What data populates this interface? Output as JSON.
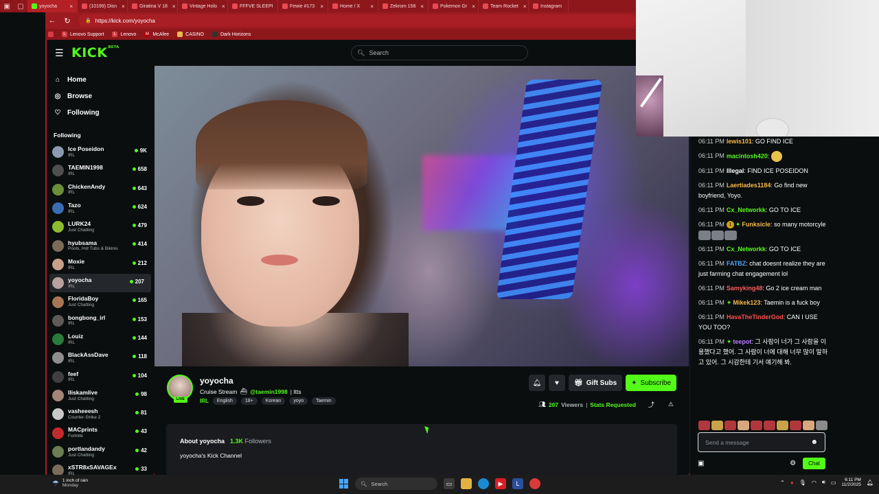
{
  "browser": {
    "tabs": [
      {
        "label": "yoyocha",
        "active": true
      },
      {
        "label": "(10199) Disn"
      },
      {
        "label": "Giratina V 18"
      },
      {
        "label": "Vintage Holo"
      },
      {
        "label": "FFFVE SLEEPI"
      },
      {
        "label": "Fewie #173"
      },
      {
        "label": "Home / X"
      },
      {
        "label": "Zekrom 158"
      },
      {
        "label": "Pokemon Gr"
      },
      {
        "label": "Team Rocket"
      },
      {
        "label": "Instagram"
      }
    ],
    "url": "https://kick.com/yoyocha",
    "bookmarks": [
      "Lenovo Support",
      "Lenovo",
      "McAfee",
      "CASINO",
      "Dark Horizons"
    ]
  },
  "header": {
    "logo": "KICK",
    "logo_badge": "BETA",
    "search_placeholder": "Search"
  },
  "sidebar": {
    "nav": [
      {
        "label": "Home",
        "icon": "home-icon"
      },
      {
        "label": "Browse",
        "icon": "compass-icon"
      },
      {
        "label": "Following",
        "icon": "heart-icon"
      }
    ],
    "following_title": "Following",
    "channels": [
      {
        "name": "Ice Poseidon",
        "category": "IRL",
        "viewers": "9K",
        "color": "#8c9bb0"
      },
      {
        "name": "TAEMIN1998",
        "category": "IRL",
        "viewers": "658",
        "color": "#4f4f4f"
      },
      {
        "name": "ChickenAndy",
        "category": "IRL",
        "viewers": "643",
        "color": "#6b8e3a"
      },
      {
        "name": "Tazo",
        "category": "IRL",
        "viewers": "624",
        "color": "#3a6db0"
      },
      {
        "name": "LURK24",
        "category": "Just Chatting",
        "viewers": "479",
        "color": "#8dbb2f"
      },
      {
        "name": "hyubsama",
        "category": "Pools, Hot Tubs & Bikinis",
        "viewers": "414",
        "color": "#7d6b5a"
      },
      {
        "name": "Moxie",
        "category": "IRL",
        "viewers": "212",
        "color": "#c7a08a"
      },
      {
        "name": "yoyocha",
        "category": "IRL",
        "viewers": "207",
        "color": "#b9a1a0",
        "active": true
      },
      {
        "name": "FloridaBoy",
        "category": "Just Chatting",
        "viewers": "165",
        "color": "#a87656"
      },
      {
        "name": "bongbong_irl",
        "category": "IRL",
        "viewers": "153",
        "color": "#5e5a55"
      },
      {
        "name": "Louiz",
        "category": "IRL",
        "viewers": "144",
        "color": "#2a7a3c"
      },
      {
        "name": "BlackAssDave",
        "category": "IRL",
        "viewers": "118",
        "color": "#8e8e8e"
      },
      {
        "name": "feef",
        "category": "IRL",
        "viewers": "104",
        "color": "#3f3f3f"
      },
      {
        "name": "lliskamlive",
        "category": "Just Chatting",
        "viewers": "98",
        "color": "#a58578"
      },
      {
        "name": "vasheeesh",
        "category": "Counter-Strike 2",
        "viewers": "81",
        "color": "#c8c8c8"
      },
      {
        "name": "MACprints",
        "category": "Fortnite",
        "viewers": "43",
        "color": "#c22b2b"
      },
      {
        "name": "portlandandy",
        "category": "Just Chatting",
        "viewers": "42",
        "color": "#6a7e52"
      },
      {
        "name": "xSTR8xSAVAGEx",
        "category": "IRL",
        "viewers": "33",
        "color": "#7a6b5c"
      }
    ]
  },
  "stream": {
    "name": "yoyocha",
    "live_label": "LIVE",
    "title_prefix": "Cruise Stream",
    "mention": "@taemin1998",
    "title_suffix": "| Itts",
    "category": "IRL",
    "tags": [
      "English",
      "18+",
      "Korean",
      "yoyo",
      "Taemin"
    ],
    "gift_label": "Gift Subs",
    "subscribe_label": "Subscribe",
    "viewers": "207",
    "viewers_label": "Viewers",
    "stats_requested": "Stats Requested",
    "about_title": "About yoyocha",
    "followers": "1.3K",
    "followers_label": "Followers",
    "about_desc": "yoyocha's Kick Channel"
  },
  "chat": {
    "messages": [
      {
        "time": "06:11 PM",
        "user": "lewis101",
        "color": "#f5b94a",
        "text": "GO FIND ICE"
      },
      {
        "time": "06:11 PM",
        "user": "macintosh420",
        "color": "#53fc18",
        "text": "",
        "emote": "face"
      },
      {
        "time": "06:11 PM",
        "user": "Illegal",
        "color": "#ffffff",
        "text": "FIND ICE POSEIDON"
      },
      {
        "time": "06:11 PM",
        "user": "Laertiades1184",
        "color": "#f5b94a",
        "text": "Go find new boyfriend, Yoyo."
      },
      {
        "time": "06:11 PM",
        "user": "Cx_Networkk",
        "color": "#53fc18",
        "text": "GO TO ICE"
      },
      {
        "time": "06:11 PM",
        "user": "Funksicle",
        "color": "#f5b94a",
        "text": "so many motorcyle",
        "badge": "1",
        "spark": true,
        "emotes": 3
      },
      {
        "time": "06:11 PM",
        "user": "Cx_Networkk",
        "color": "#53fc18",
        "text": "GO TO ICE"
      },
      {
        "time": "06:11 PM",
        "user": "FATBZ",
        "color": "#4fa3ff",
        "text": "chat doesnt realize they are just farming chat engagement lol"
      },
      {
        "time": "06:11 PM",
        "user": "Samyking48",
        "color": "#ff5a5a",
        "text": "Go 2 ice cream man"
      },
      {
        "time": "06:11 PM",
        "user": "Mikek123",
        "color": "#f5b94a",
        "text": "Taemin is a fuck boy",
        "spark": true
      },
      {
        "time": "06:11 PM",
        "user": "HavaTheTinderGod",
        "color": "#ff4f4f",
        "text": "CAN I USE YOU TOO?"
      },
      {
        "time": "06:11 PM",
        "user": "teepot",
        "color": "#b57cff",
        "text": "그 사람이 너가 그 사람을 이용했다고 했어. 그 사람이 너에 대해 너무 많이 말하고 있어. 그 시감한테 기서 얘기해 봐.",
        "spark": true
      }
    ],
    "input_placeholder": "Send a message",
    "send_label": "Chat"
  },
  "taskbar": {
    "weather_line1": "1 inch of rain",
    "weather_line2": "Monday",
    "search_placeholder": "Search",
    "time": "6:11 PM",
    "date": "11/2/2025"
  }
}
